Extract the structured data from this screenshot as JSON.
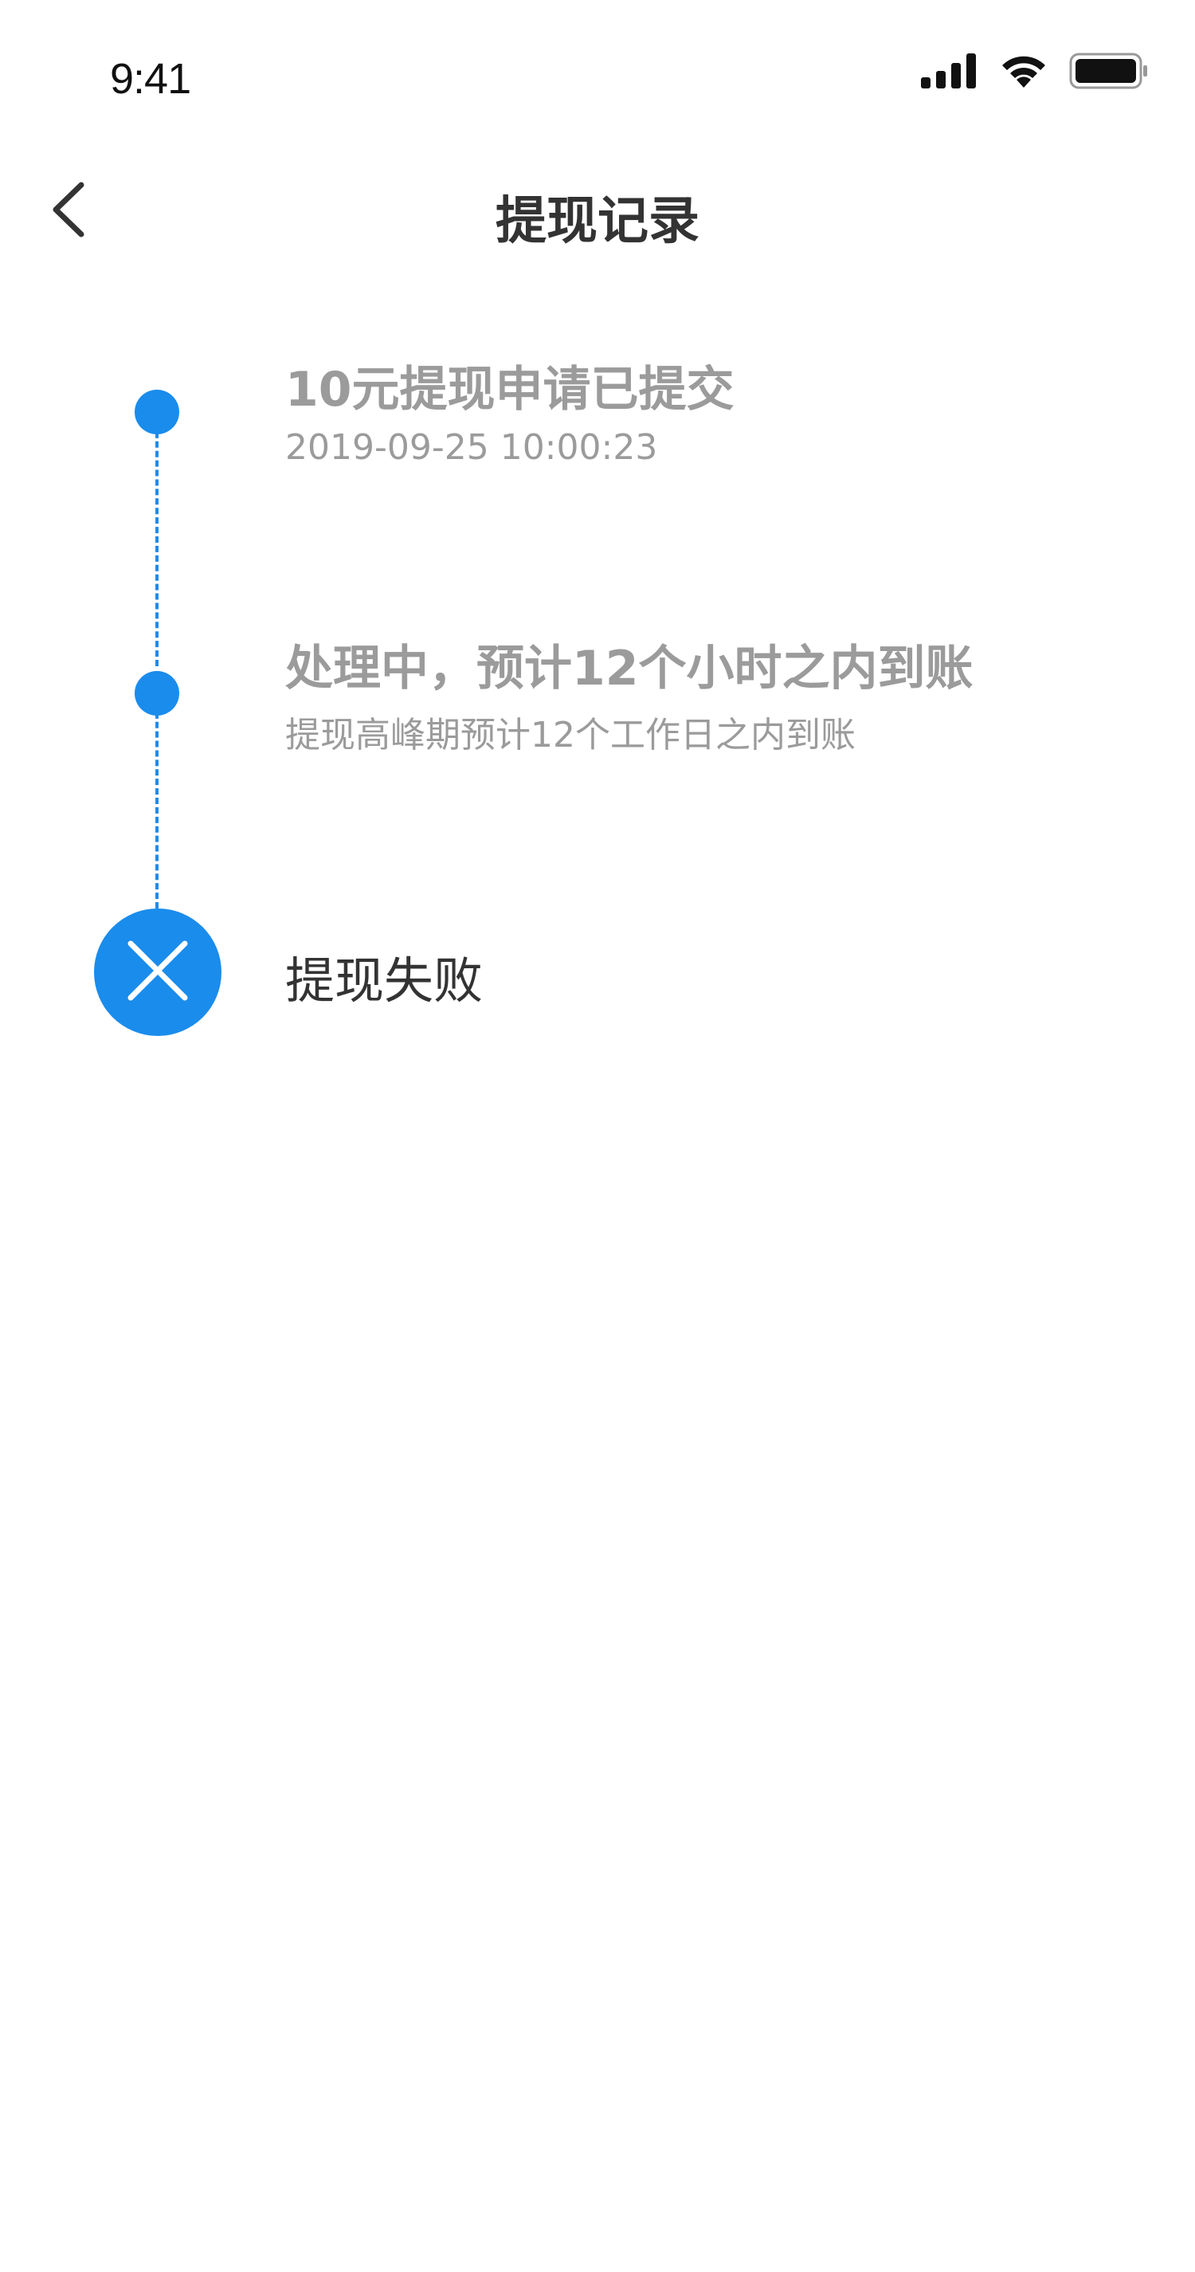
{
  "status_bar": {
    "time": "9:41",
    "icons": [
      "signal-icon",
      "wifi-icon",
      "battery-icon"
    ]
  },
  "nav": {
    "title": "提现记录",
    "back_icon": "chevron-left-icon"
  },
  "timeline": {
    "accent_color": "#1a8cec",
    "steps": [
      {
        "title": "10元提现申请已提交",
        "subtitle": "2019-09-25 10:00:23",
        "state": "done"
      },
      {
        "title": "处理中，预计12个小时之内到账",
        "subtitle": "提现高峰期预计12个工作日之内到账",
        "state": "done"
      },
      {
        "title": "提现失败",
        "state": "failed",
        "icon": "close-icon"
      }
    ]
  }
}
